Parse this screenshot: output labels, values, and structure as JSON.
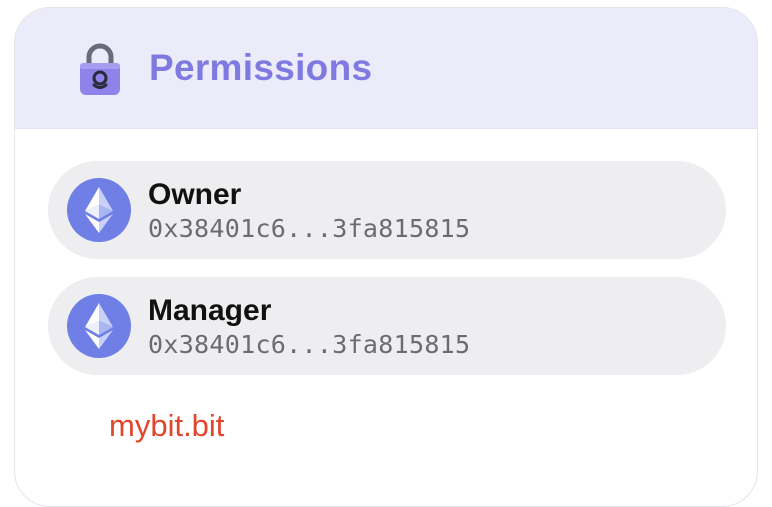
{
  "header": {
    "title": "Permissions",
    "icon": "padlock-icon",
    "title_color": "#7e7ae0",
    "background": "#ecebfa"
  },
  "roles": [
    {
      "label": "Owner",
      "address": "0x38401c6...3fa815815",
      "icon": "ethereum-icon"
    },
    {
      "label": "Manager",
      "address": "0x38401c6...3fa815815",
      "icon": "ethereum-icon"
    }
  ],
  "domain": {
    "name": "mybit.bit",
    "color": "#e1462c"
  },
  "colors": {
    "eth_circle": "#6f7fe6",
    "row_background": "#eeeef0"
  }
}
